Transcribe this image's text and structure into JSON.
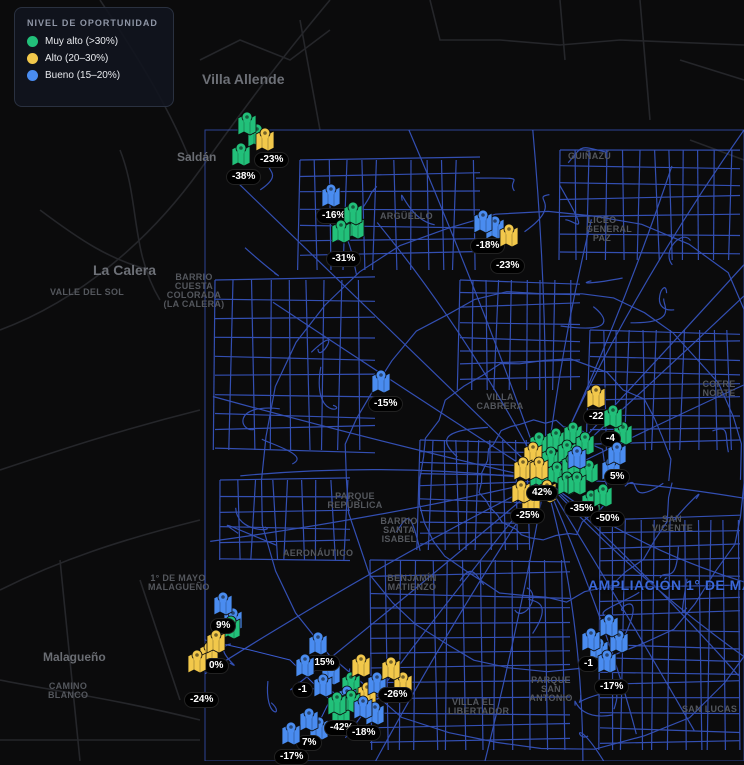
{
  "legend": {
    "title": "NIVEL DE OPORTUNIDAD",
    "items": [
      {
        "label": "Muy alto (>30%)",
        "color": "#22c07a"
      },
      {
        "label": "Alto (20–30%)",
        "color": "#f2c84b"
      },
      {
        "label": "Bueno (15–20%)",
        "color": "#4a8cf0"
      }
    ]
  },
  "colors": {
    "green": "#22c07a",
    "yellow": "#f2c84b",
    "blue": "#4a8cf0",
    "road": "#3a5bd0",
    "background": "#0b0b0c"
  },
  "places": [
    {
      "id": "villa-allende",
      "text": "Villa Allende"
    },
    {
      "id": "saldan",
      "text": "Saldán"
    },
    {
      "id": "la-calera",
      "text": "La Calera"
    },
    {
      "id": "valle-del-sol",
      "text": "VALLE DEL SOL"
    },
    {
      "id": "barrio-cuesta",
      "text": "BARRIO CUESTA COLORADA (LA CALERA)"
    },
    {
      "id": "guinazu",
      "text": "GUIÑAZÚ"
    },
    {
      "id": "liceo",
      "text": "LICEO GENERAL PAZ"
    },
    {
      "id": "arguello",
      "text": "ARGÜELLO"
    },
    {
      "id": "villa-cabrera",
      "text": "VILLA CABRERA"
    },
    {
      "id": "parque-republica",
      "text": "PARQUE REPÚBLICA"
    },
    {
      "id": "barrio-santa-isabel",
      "text": "BARRIO SANTA ISABEL"
    },
    {
      "id": "aeronautico",
      "text": "AERONÁUTICO"
    },
    {
      "id": "primero-de-mayo",
      "text": "1° DE MAYO MALAGUEÑO"
    },
    {
      "id": "benjamin",
      "text": "BENJAMÍN MATIENZO"
    },
    {
      "id": "malagueno",
      "text": "Malagueño"
    },
    {
      "id": "camino-blanco",
      "text": "CAMINO BLANCO"
    },
    {
      "id": "villa-el-libertador",
      "text": "VILLA EL LIBERTADOR"
    },
    {
      "id": "parque-san-antonio",
      "text": "PARQUE SAN ANTONIO"
    },
    {
      "id": "san-vicente",
      "text": "SAN VICENTE"
    },
    {
      "id": "san-lucas",
      "text": "SAN LUCAS"
    },
    {
      "id": "cofre-norte",
      "text": "COFRE NORTE"
    },
    {
      "id": "ampliacion",
      "text": "AMPLIACIÓN 1° DE MA"
    }
  ],
  "markers": [
    {
      "color": "green",
      "label": "",
      "lx": 0,
      "ly": 0
    },
    {
      "color": "yellow",
      "label": "-23%"
    },
    {
      "color": "green",
      "label": "-38%"
    },
    {
      "color": "blue",
      "label": "-16%"
    },
    {
      "color": "green",
      "label": ""
    },
    {
      "color": "green",
      "label": "-31%"
    },
    {
      "color": "blue",
      "label": "-18%"
    },
    {
      "color": "yellow",
      "label": "-23%"
    },
    {
      "color": "blue",
      "label": "-15%"
    },
    {
      "color": "yellow",
      "label": "-22%"
    },
    {
      "color": "green",
      "label": "-4"
    },
    {
      "color": "blue",
      "label": "5%"
    },
    {
      "color": "green",
      "label": "-35%"
    },
    {
      "color": "green",
      "label": "-50%"
    },
    {
      "color": "yellow",
      "label": "-25%"
    },
    {
      "color": "yellow",
      "label": "42%"
    },
    {
      "color": "blue",
      "label": "9%"
    },
    {
      "color": "yellow",
      "label": "0%"
    },
    {
      "color": "yellow",
      "label": "-24%"
    },
    {
      "color": "blue",
      "label": "-15%"
    },
    {
      "color": "blue",
      "label": "-1"
    },
    {
      "color": "yellow",
      "label": "-26%"
    },
    {
      "color": "green",
      "label": "-42%"
    },
    {
      "color": "blue",
      "label": "-18%"
    },
    {
      "color": "blue",
      "label": "7%"
    },
    {
      "color": "blue",
      "label": "-17%"
    },
    {
      "color": "blue",
      "label": "-1"
    },
    {
      "color": "blue",
      "label": "-17%"
    }
  ]
}
